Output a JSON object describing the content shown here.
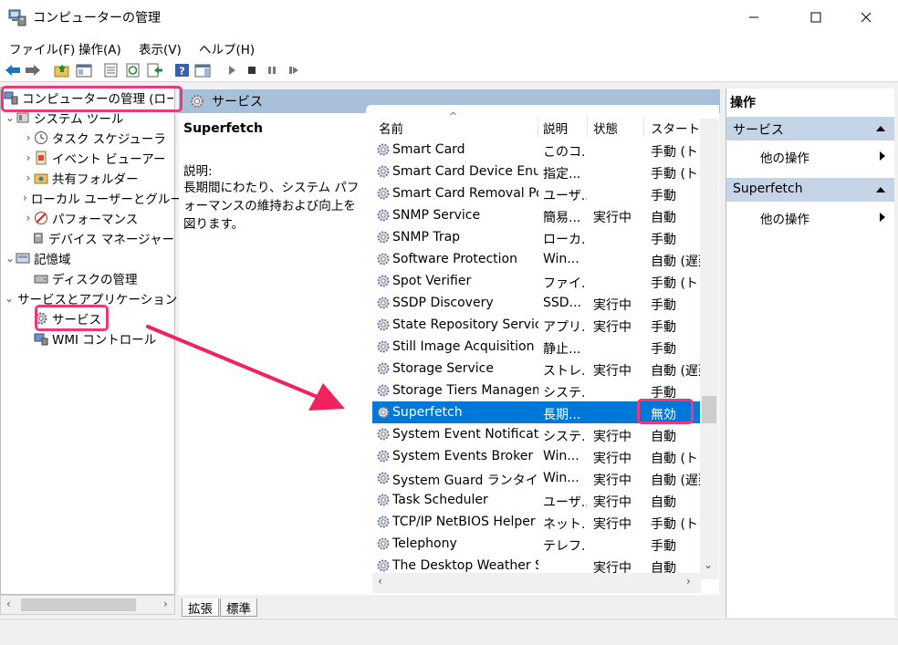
{
  "window": {
    "title": "コンピューターの管理",
    "minimize": "—",
    "maximize": "☐",
    "close": "✕"
  },
  "menu": [
    "ファイル(F)",
    "操作(A)",
    "表示(V)",
    "ヘルプ(H)"
  ],
  "tree": {
    "root": "コンピューターの管理 (ローカル)",
    "items": [
      {
        "label": "システム ツール",
        "indent": 1,
        "chev": "⌄",
        "icon": "tools-icon"
      },
      {
        "label": "タスク スケジューラ",
        "indent": 2,
        "chev": "›",
        "icon": "clock-icon"
      },
      {
        "label": "イベント ビューアー",
        "indent": 2,
        "chev": "›",
        "icon": "event-viewer-icon"
      },
      {
        "label": "共有フォルダー",
        "indent": 2,
        "chev": "›",
        "icon": "shared-folder-icon"
      },
      {
        "label": "ローカル ユーザーとグループ",
        "indent": 2,
        "chev": "›",
        "icon": "users-icon"
      },
      {
        "label": "パフォーマンス",
        "indent": 2,
        "chev": "›",
        "icon": "performance-icon"
      },
      {
        "label": "デバイス マネージャー",
        "indent": 2,
        "chev": "",
        "icon": "device-manager-icon"
      },
      {
        "label": "記憶域",
        "indent": 1,
        "chev": "⌄",
        "icon": "storage-icon"
      },
      {
        "label": "ディスクの管理",
        "indent": 2,
        "chev": "",
        "icon": "disk-icon"
      },
      {
        "label": "サービスとアプリケーション",
        "indent": 1,
        "chev": "⌄",
        "icon": "services-apps-icon"
      },
      {
        "label": "サービス",
        "indent": 2,
        "chev": "",
        "icon": "gear-icon"
      },
      {
        "label": "WMI コントロール",
        "indent": 2,
        "chev": "",
        "icon": "wmi-icon"
      }
    ]
  },
  "middle": {
    "header": "サービス",
    "selected_name": "Superfetch",
    "desc_label": "説明:",
    "desc_text": "長期間にわたり、システム パフォーマンスの維持および向上を図ります。"
  },
  "columns": [
    "名前",
    "説明",
    "状態",
    "スタートアップの種類"
  ],
  "services": [
    {
      "name": "Smart Card",
      "desc": "このコ...",
      "status": "",
      "startup": "手動 (トリガー開始)"
    },
    {
      "name": "Smart Card Device Enumeration Service",
      "desc": "指定...",
      "status": "",
      "startup": "手動 (トリガー開始)"
    },
    {
      "name": "Smart Card Removal Policy",
      "desc": "ユーザ...",
      "status": "",
      "startup": "手動"
    },
    {
      "name": "SNMP Service",
      "desc": "簡易...",
      "status": "実行中",
      "startup": "自動"
    },
    {
      "name": "SNMP Trap",
      "desc": "ローカ...",
      "status": "",
      "startup": "手動"
    },
    {
      "name": "Software Protection",
      "desc": "Win...",
      "status": "",
      "startup": "自動 (遅延開始)"
    },
    {
      "name": "Spot Verifier",
      "desc": "ファイ...",
      "status": "",
      "startup": "手動 (トリガー開始)"
    },
    {
      "name": "SSDP Discovery",
      "desc": "SSD...",
      "status": "実行中",
      "startup": "手動"
    },
    {
      "name": "State Repository Service",
      "desc": "アプリ...",
      "status": "実行中",
      "startup": "手動"
    },
    {
      "name": "Still Image Acquisition Events",
      "desc": "静止...",
      "status": "",
      "startup": "手動"
    },
    {
      "name": "Storage Service",
      "desc": "ストレ...",
      "status": "実行中",
      "startup": "自動 (遅延開始)"
    },
    {
      "name": "Storage Tiers Management",
      "desc": "システ...",
      "status": "",
      "startup": "手動"
    },
    {
      "name": "Superfetch",
      "desc": "長期...",
      "status": "",
      "startup": "無効",
      "selected": true
    },
    {
      "name": "System Event Notification Service",
      "desc": "システ...",
      "status": "実行中",
      "startup": "自動"
    },
    {
      "name": "System Events Broker",
      "desc": "Win...",
      "status": "実行中",
      "startup": "自動 (トリガー開始)"
    },
    {
      "name": "System Guard ランタイム モニター ブローカー",
      "desc": "Win...",
      "status": "実行中",
      "startup": "自動 (遅延開始)"
    },
    {
      "name": "Task Scheduler",
      "desc": "ユーザ...",
      "status": "実行中",
      "startup": "自動"
    },
    {
      "name": "TCP/IP NetBIOS Helper",
      "desc": "ネット...",
      "status": "実行中",
      "startup": "手動 (トリガー開始)"
    },
    {
      "name": "Telephony",
      "desc": "テレフ...",
      "status": "",
      "startup": "手動"
    },
    {
      "name": "The Desktop Weather Service",
      "desc": "",
      "status": "実行中",
      "startup": "自動"
    }
  ],
  "tabs": [
    "拡張",
    "標準"
  ],
  "actions": {
    "title": "操作",
    "section1": "サービス",
    "section2": "Superfetch",
    "more": "他の操作"
  },
  "colors": {
    "highlight": "#ea3a7a",
    "selection": "#0078d7",
    "header_bg": "#a8bfd9"
  }
}
